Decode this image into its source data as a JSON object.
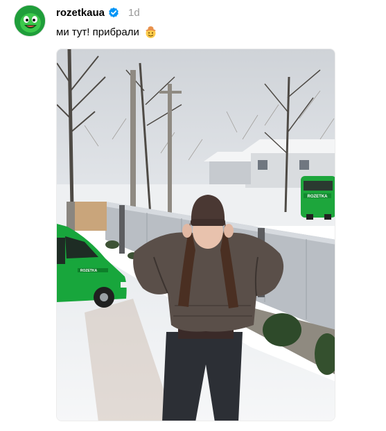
{
  "post": {
    "username": "rozetkaua",
    "verified_icon": "verified-badge-icon",
    "time": "1d",
    "caption": "ми тут! прибрали",
    "caption_emoji": "cowboy-face-emoji",
    "van_logo_text": "ROZETKA",
    "van_side_text": "ROZETKA"
  },
  "colors": {
    "verified_blue": "#0095f6",
    "brand_green": "#18a63c",
    "muted_text": "#999999"
  }
}
